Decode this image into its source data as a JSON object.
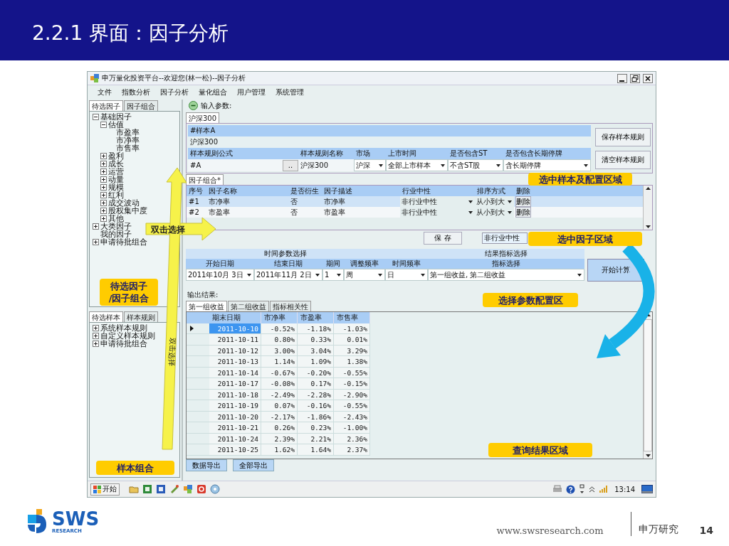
{
  "slide": {
    "title": "2.2.1 界面：因子分析"
  },
  "app": {
    "title": "申万量化投资平台--欢迎您(林一松)--因子分析",
    "menu": [
      "文件",
      "指数分析",
      "因子分析",
      "量化组合",
      "用户管理",
      "系统管理"
    ],
    "factor_tabs": [
      {
        "label": "待选因子",
        "selected": true
      },
      {
        "label": "因子组合",
        "selected": false
      }
    ],
    "factor_tree": [
      {
        "label": "基础因子",
        "expanded": true,
        "children": [
          {
            "label": "估值",
            "expanded": true,
            "children": [
              {
                "label": "市盈率"
              },
              {
                "label": "市净率"
              },
              {
                "label": "市售率"
              }
            ]
          },
          {
            "label": "盈利",
            "expanded": false
          },
          {
            "label": "成长",
            "expanded": false
          },
          {
            "label": "运营",
            "expanded": false
          },
          {
            "label": "动量",
            "expanded": false
          },
          {
            "label": "规模",
            "expanded": false
          },
          {
            "label": "红利",
            "expanded": false
          },
          {
            "label": "成交波动",
            "expanded": false
          },
          {
            "label": "股权集中度",
            "expanded": false
          },
          {
            "label": "其他",
            "expanded": false
          }
        ]
      },
      {
        "label": "大类因子",
        "expanded": false
      },
      {
        "label": "我的因子"
      },
      {
        "label": "申请待批组合",
        "expanded": false
      }
    ],
    "sample_tabs": [
      {
        "label": "待选样本",
        "selected": true
      },
      {
        "label": "样本规则",
        "selected": false
      }
    ],
    "sample_tree": [
      {
        "label": "系统样本规则",
        "expanded": false
      },
      {
        "label": "自定义样本规则",
        "expanded": false
      },
      {
        "label": "申请待批组合",
        "expanded": false
      }
    ],
    "input_params": {
      "label": "输入参数:",
      "expanded": true
    },
    "index_tabs": [
      {
        "label": "沪深300",
        "selected": true
      }
    ],
    "sample": {
      "name": "#样本A",
      "index": "沪深300",
      "columns": [
        "样本规则公式",
        "样本规则名称",
        "市场",
        "上市时间",
        "是否包含ST",
        "是否包含长期停牌"
      ],
      "fields": [
        {
          "kind": "browse",
          "value": "#A",
          "button": ".."
        },
        {
          "kind": "text",
          "value": "沪深300"
        },
        {
          "kind": "dropdown",
          "value": "沪深"
        },
        {
          "kind": "dropdown",
          "value": "全部上市样本"
        },
        {
          "kind": "dropdown",
          "value": "不含ST股"
        },
        {
          "kind": "dropdown",
          "value": "含长期停牌"
        }
      ]
    },
    "sample_buttons": [
      "保存样本规则",
      "清空样本规则"
    ],
    "combo_tabs": [
      {
        "label": "因子组合*",
        "selected": true
      }
    ],
    "factor_grid": {
      "columns": [
        "序号",
        "因子名称",
        "是否衍生",
        "因子描述",
        "行业中性",
        "排序方式",
        "删除"
      ],
      "rows": [
        {
          "index": "#1",
          "name": "市净率",
          "derived": "否",
          "desc": "市净率",
          "neutral": "非行业中性",
          "order": "从小到大",
          "delete": "删除",
          "selected": true
        },
        {
          "index": "#2",
          "name": "市盈率",
          "derived": "否",
          "desc": "市盈率",
          "neutral": "非行业中性",
          "order": "从小到大",
          "delete": "删除",
          "selected": false
        }
      ]
    },
    "save_button": "保 存",
    "neutral_field": "非行业中性",
    "params": {
      "groups": [
        "时间参数选择",
        "结果指标选择"
      ],
      "fields": [
        {
          "label": "开始日期",
          "value": "2011年10月 3日"
        },
        {
          "label": "结束日期",
          "value": "2011年11月 2日"
        },
        {
          "label": "期间",
          "value": "1"
        },
        {
          "label": "调整频率",
          "value": "周"
        },
        {
          "label": "时间频率",
          "value": "日"
        },
        {
          "label": "指标选择",
          "value": "第一组收益, 第二组收益"
        }
      ],
      "run_button": "开始计算"
    },
    "output_label": "输出结果:",
    "result_tabs": [
      {
        "label": "第一组收益",
        "selected": true
      },
      {
        "label": "第二组收益",
        "selected": false
      },
      {
        "label": "指标相关性",
        "selected": false
      }
    ],
    "result_grid": {
      "columns": [
        "期末日期",
        "市净率",
        "市盈率",
        "市售率"
      ],
      "rows": [
        {
          "date": "2011-10-10",
          "pb": "-0.52%",
          "pe": "-1.18%",
          "ps": "-1.03%",
          "selected": true
        },
        {
          "date": "2011-10-11",
          "pb": "0.80%",
          "pe": "0.33%",
          "ps": "0.01%",
          "selected": false
        },
        {
          "date": "2011-10-12",
          "pb": "3.00%",
          "pe": "3.04%",
          "ps": "3.29%",
          "selected": false
        },
        {
          "date": "2011-10-13",
          "pb": "1.14%",
          "pe": "1.09%",
          "ps": "1.38%",
          "selected": false
        },
        {
          "date": "2011-10-14",
          "pb": "-0.67%",
          "pe": "-0.20%",
          "ps": "-0.55%",
          "selected": false
        },
        {
          "date": "2011-10-17",
          "pb": "-0.08%",
          "pe": "0.17%",
          "ps": "-0.15%",
          "selected": false
        },
        {
          "date": "2011-10-18",
          "pb": "-2.49%",
          "pe": "-2.28%",
          "ps": "-2.90%",
          "selected": false
        },
        {
          "date": "2011-10-19",
          "pb": "0.07%",
          "pe": "-0.16%",
          "ps": "-0.55%",
          "selected": false
        },
        {
          "date": "2011-10-20",
          "pb": "-2.17%",
          "pe": "-1.86%",
          "ps": "-2.43%",
          "selected": false
        },
        {
          "date": "2011-10-21",
          "pb": "0.26%",
          "pe": "0.23%",
          "ps": "-1.00%",
          "selected": false
        },
        {
          "date": "2011-10-24",
          "pb": "2.39%",
          "pe": "2.21%",
          "ps": "2.36%",
          "selected": false
        },
        {
          "date": "2011-10-25",
          "pb": "1.62%",
          "pe": "1.64%",
          "ps": "2.37%",
          "selected": false
        }
      ]
    },
    "export_buttons": [
      "数据导出",
      "全部导出"
    ],
    "taskbar": {
      "start": "开始",
      "time": "13:14"
    }
  },
  "callouts": [
    {
      "lines": [
        "选中样本及配置区域"
      ]
    },
    {
      "lines": [
        "选中因子区域"
      ]
    },
    {
      "lines": [
        "选择参数配置区"
      ]
    },
    {
      "lines": [
        "查询结果区域"
      ]
    },
    {
      "lines": [
        "待选因子",
        "/因子组合"
      ]
    },
    {
      "lines": [
        "样本组合"
      ]
    }
  ],
  "arrows": [
    {
      "label": "双击选择"
    },
    {
      "label": "双击选择"
    }
  ],
  "footer": {
    "logo_text": "SWS",
    "logo_subtext": "RESEARCH",
    "url": "www.swsresearch.com",
    "org": "申万研究",
    "page": "14"
  }
}
